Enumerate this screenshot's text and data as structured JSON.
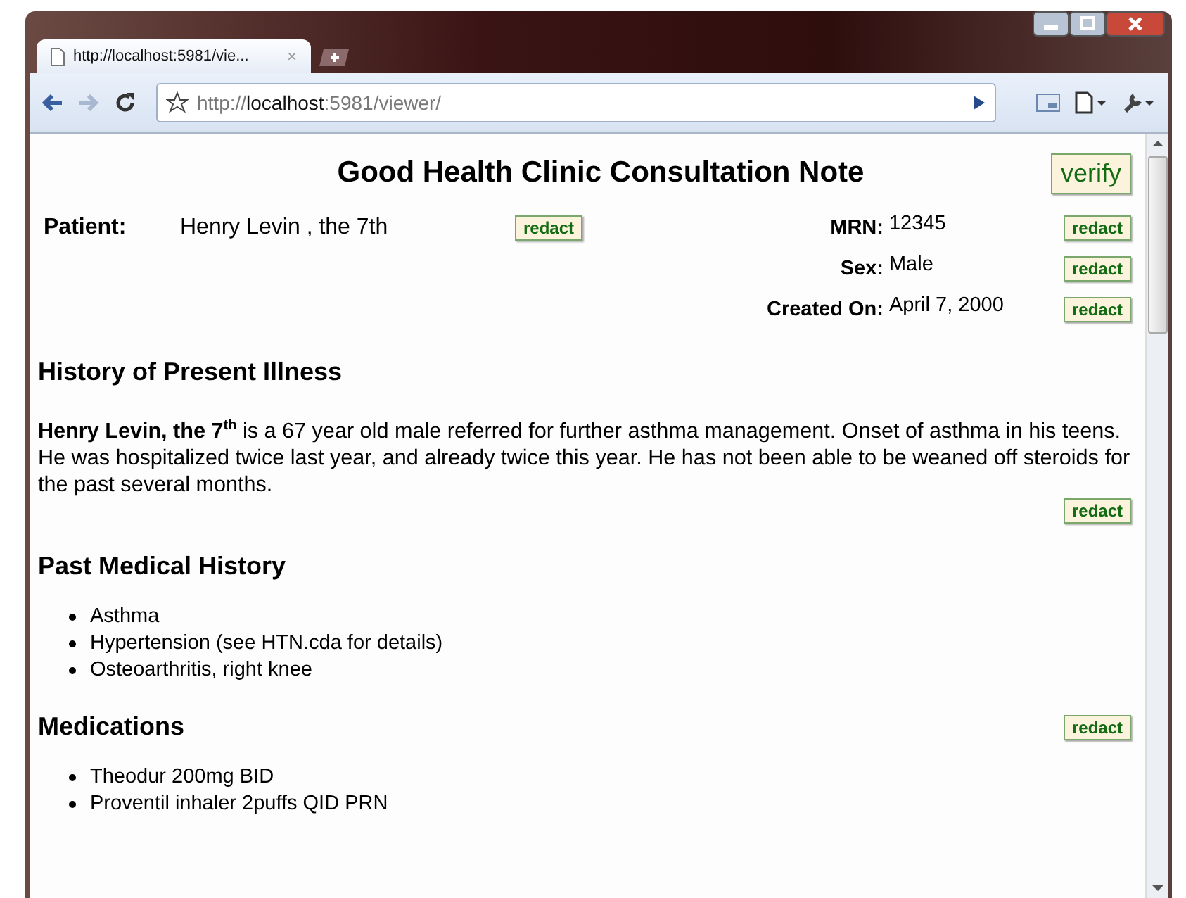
{
  "tab": {
    "title": "http://localhost:5981/vie...",
    "close": "×",
    "selected": true
  },
  "address": {
    "value": "http://**localhost**:5981/viewer/"
  },
  "document": {
    "title": "Good Health Clinic Consultation Note",
    "verify_button": "verify",
    "patient": {
      "label": "Patient:",
      "value": "Henry Levin , the 7th",
      "redact_button": "redact"
    },
    "fields": [
      {
        "label": "MRN:",
        "value": "12345",
        "redact_button": "redact"
      },
      {
        "label": "Sex:",
        "value": "Male",
        "redact_button": "redact"
      },
      {
        "label": "Created On:",
        "value": "April 7, 2000",
        "redact_button": "redact"
      }
    ],
    "sections": [
      {
        "kind": "paragraph",
        "heading": "History of Present Illness",
        "text": "**Henry Levin, the 7**$^{th}$ is a 67 year old male referred for further asthma management. Onset of asthma in his teens. He was hospitalized twice last year, and already twice this year. He has not been able to be weaned off steroids for the past several months.",
        "redact_button": "redact"
      },
      {
        "kind": "list",
        "heading": "Past Medical History",
        "items": [
          "Asthma",
          "Hypertension (see HTN.cda for details)",
          "Osteoarthritis, right knee"
        ]
      },
      {
        "kind": "list",
        "heading": "Medications",
        "items": [
          "Theodur 200mg BID",
          "Proventil inhaler 2puffs QID PRN"
        ],
        "redact_button": "redact"
      }
    ]
  }
}
